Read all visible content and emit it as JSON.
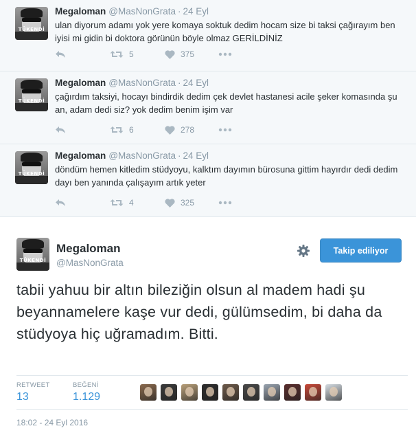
{
  "tweets": [
    {
      "name": "Megaloman",
      "handle": "@MasNonGrata",
      "date": "24 Eyl",
      "text": "ulan diyorum adamı yok yere komaya soktuk dedim hocam size bi taksi çağırayım ben iyisi mi gidin bi doktora görünün böyle olmaz GERİLDİNİZ",
      "retweets": "5",
      "likes": "375",
      "avatar_label": "TÜKENDİ"
    },
    {
      "name": "Megaloman",
      "handle": "@MasNonGrata",
      "date": "24 Eyl",
      "text": "çağırdım taksiyi, hocayı bindirdik dedim çek devlet hastanesi acile şeker komasında şu an, adam dedi siz? yok dedim benim işim var",
      "retweets": "6",
      "likes": "278",
      "avatar_label": "TÜKENDİ"
    },
    {
      "name": "Megaloman",
      "handle": "@MasNonGrata",
      "date": "24 Eyl",
      "text": "döndüm hemen kitledim stüdyoyu, kalktım dayımın bürosuna gittim hayırdır dedi dedim dayı ben yanında çalışayım artık yeter",
      "retweets": "4",
      "likes": "325",
      "avatar_label": "TÜKENDİ"
    }
  ],
  "main": {
    "name": "Megaloman",
    "handle": "@MasNonGrata",
    "avatar_label": "TÜKENDİ",
    "follow_label": "Takip ediliyor",
    "text": "tabii yahuu bir altın bileziğin olsun al madem hadi şu beyannamelere kaşe vur dedi, gülümsedim, bi daha da stüdyoya hiç uğramadım. Bitti.",
    "retweet_label": "RETWEET",
    "retweet_count": "13",
    "like_label": "BEĞENİ",
    "like_count": "1.129",
    "timestamp": "18:02 - 24 Eyl 2016"
  },
  "icons": {
    "reply": "reply-icon",
    "retweet": "retweet-icon",
    "like": "heart-icon",
    "more": "more-icon",
    "settings": "gear-icon"
  },
  "colors": {
    "accent": "#3b94d9",
    "muted": "#8899a6",
    "icon": "#aab8c2",
    "tweet_bg": "#f5f8fa"
  },
  "liker_colors": [
    "#8a6a4e",
    "#3b3b3b",
    "#b9a07a",
    "#2e2e2e",
    "#6d5a4a",
    "#4a4a4a",
    "#9aa4b0",
    "#5a2e2e",
    "#c84a3a",
    "#d6dde3"
  ]
}
